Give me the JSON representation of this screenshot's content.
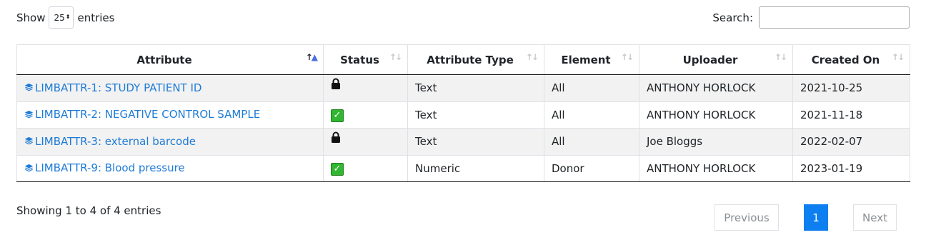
{
  "length": {
    "show_label": "Show",
    "value": "25",
    "entries_label": "entries"
  },
  "search": {
    "label": "Search:",
    "value": ""
  },
  "table": {
    "columns": [
      "Attribute",
      "Status",
      "Attribute Type",
      "Element",
      "Uploader",
      "Created On"
    ],
    "rows": [
      {
        "attribute": "LIMBATTR-1: STUDY PATIENT ID",
        "status": "lock",
        "type": "Text",
        "element": "All",
        "uploader": "ANTHONY HORLOCK",
        "created": "2021-10-25"
      },
      {
        "attribute": "LIMBATTR-2: NEGATIVE CONTROL SAMPLE",
        "status": "check",
        "type": "Text",
        "element": "All",
        "uploader": "ANTHONY HORLOCK",
        "created": "2021-11-18"
      },
      {
        "attribute": "LIMBATTR-3: external barcode",
        "status": "lock",
        "type": "Text",
        "element": "All",
        "uploader": "Joe Bloggs",
        "created": "2022-02-07"
      },
      {
        "attribute": "LIMBATTR-9: Blood pressure",
        "status": "check",
        "type": "Numeric",
        "element": "Donor",
        "uploader": "ANTHONY HORLOCK",
        "created": "2023-01-19"
      }
    ]
  },
  "info": "Showing 1 to 4 of 4 entries",
  "pagination": {
    "previous": "Previous",
    "current": "1",
    "next": "Next"
  },
  "icons": {
    "attribute_link": "layers-icon",
    "status_locked": "lock-icon",
    "status_checked": "checkbox-checked-icon",
    "sort": "sort-arrows-icon"
  },
  "colors": {
    "link": "#1e7bd6",
    "page_active": "#0d7ff0",
    "check_green": "#31b731",
    "striped_row": "#f2f2f2"
  }
}
